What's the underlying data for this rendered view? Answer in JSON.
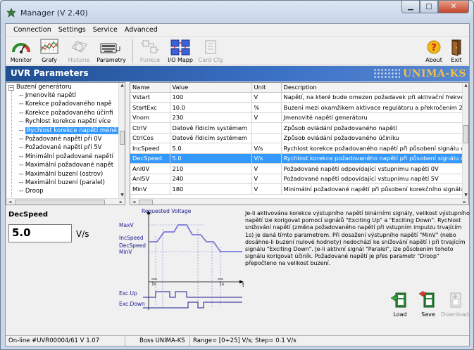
{
  "window": {
    "title": "Manager (V 2.40)"
  },
  "menu": [
    "Connection",
    "Settings",
    "Service",
    "Advanced"
  ],
  "toolbar": {
    "monitor": "Monitor",
    "grafy": "Grafy",
    "historie": "Historie",
    "parametry": "Parametry",
    "funkce": "Funkce",
    "io_mapp": "I/O Mapp",
    "card_cfg": "Card Cfg",
    "about": "About",
    "exit": "Exit"
  },
  "header": {
    "title": "UVR Parameters",
    "logo": "UNIMA-KS"
  },
  "tree": {
    "root": "Buzení generátoru",
    "items": [
      "Jmenovité napětí",
      "Korekce požadovaného napě",
      "Korekce požadovaného účinfi",
      "Rychlost korekce napětí více",
      "Rychlost korekce napětí méně",
      "Požadované napětí při 0V",
      "Požadované napětí při 5V",
      "Minimální požadované napětí",
      "Maximální požadované napět",
      "Maximální buzení (ostrov)",
      "Maximální buzení (paralel)",
      "Droop"
    ],
    "selected_index": 4
  },
  "grid": {
    "columns": [
      "Name",
      "Value",
      "Unit",
      "Description"
    ],
    "rows": [
      [
        "Vstart",
        "100",
        "V",
        "Napětí, na které bude omezen požadavek při aktivační frekvenc"
      ],
      [
        "StartExc",
        "10.0",
        "%",
        "Buzení mezi okamžikem aktivace regulátoru a překročením 26V"
      ],
      [
        "Vnom",
        "230",
        "V",
        "Jmenovité napětí generátoru"
      ],
      [
        "CtrlV",
        "Datově řídicím systémem",
        "",
        "Způsob ovládání požadovaného napětí"
      ],
      [
        "CtrlCos",
        "Datově řídicím systémem",
        "",
        "Způsob ovládání požadovaného účiníku"
      ],
      [
        "IncSpeed",
        "5.0",
        "V/s",
        "Rychlost korekce požadovaného napětí při působení signálu otá"
      ],
      [
        "DecSpeed",
        "5.0",
        "V/s",
        "Rychlost korekce požadovaného napětí při působení signálu otá"
      ],
      [
        "AnI0V",
        "210",
        "V",
        "Požadované napětí odpovídající vstupnímu napětí 0V"
      ],
      [
        "AnI5V",
        "240",
        "V",
        "Požadované napětí odpovídající vstupnímu napětí 5V"
      ],
      [
        "MinV",
        "180",
        "V",
        "Minimální požadované napětí při působení korekčního signálu"
      ]
    ],
    "selected_index": 6
  },
  "detail": {
    "name": "DecSpeed",
    "value": "5.0",
    "unit": "V/s",
    "description": "Je-li aktivována korekce výstupního napětí binárními signály, velikost výstupního napětí lze korigovat pomocí signálů \"Exciting Up\" a \"Exciting Down\". Rychlost snižování napětí (změna požadovaného napětí při vstupním impulzu trvajícím 1s) je daná tímto parametrem. Při dosažení výstupního napětí \"MinV\" (nebo dosáhne-li buzení nulové hodnoty) nedochází ke snižování napětí i při trvajícím signálu \"Exciting Down\". Je-li aktivní signál \"Paralel\", lze působením tohoto signálu korigovat účiník. Požadované napětí je přes parametr \"Droop\" přepočteno na velikost buzení."
  },
  "diagram": {
    "title": "Requested Voltage",
    "maxv": "MaxV",
    "incspeed": "IncSpeed",
    "decspeed": "DecSpeed",
    "minv": "MinV",
    "t": "t",
    "one_s_a": "1s",
    "one_s_b": "1s",
    "exc_up": "Exc.Up",
    "exc_down": "Exc.Down"
  },
  "actions": {
    "load": "Load",
    "save": "Save",
    "download": "Download"
  },
  "status": {
    "conn": "On-line #UVR00004/61  V 1.07",
    "device": "Boss UNIMA-KS",
    "range": "Range= [0÷25] V/s; Step= 0.1 V/s"
  }
}
